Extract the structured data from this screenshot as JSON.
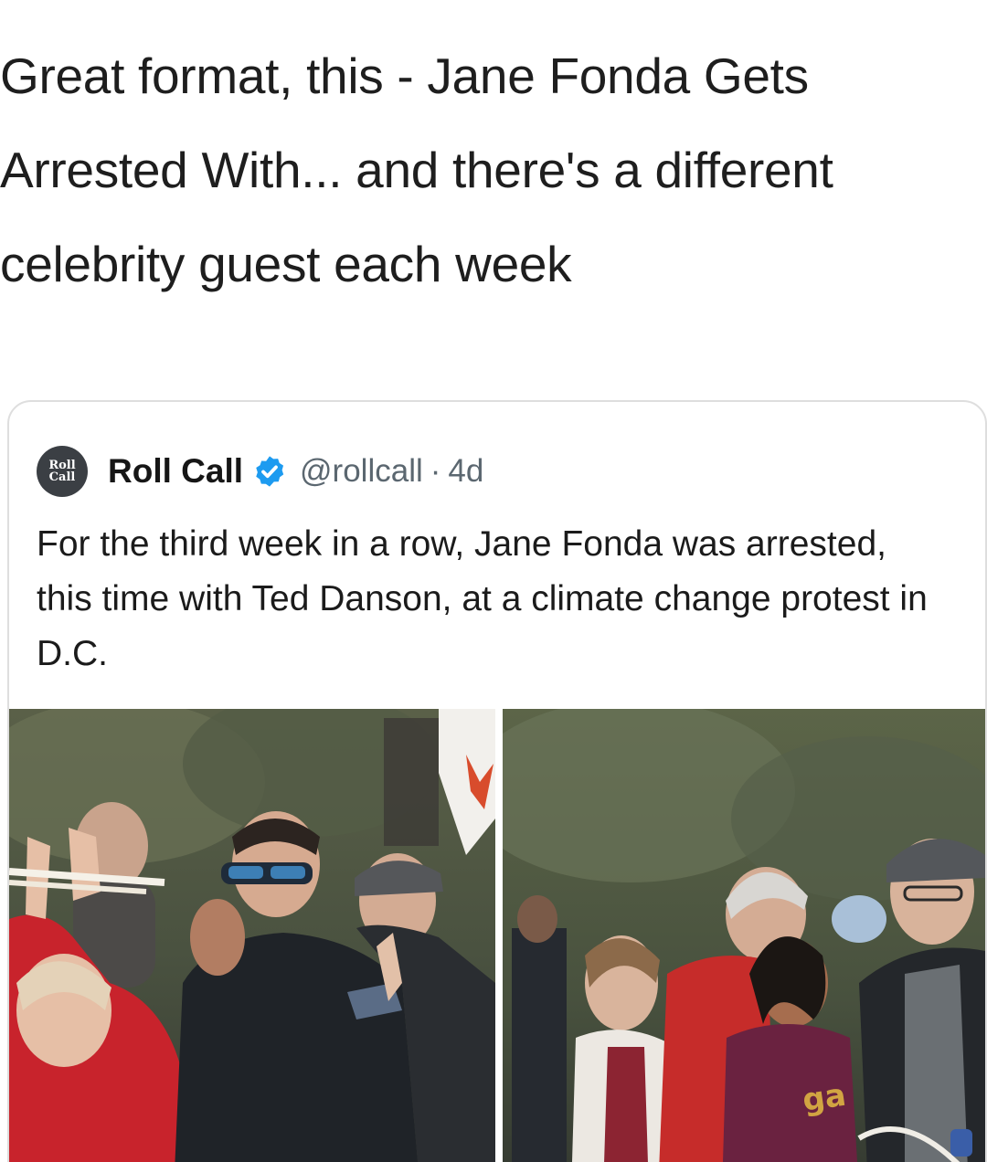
{
  "post": {
    "caption": "Great format, this - Jane Fonda Gets Arrested With... and there's a different celebrity guest each week"
  },
  "tweet": {
    "avatar": {
      "line1": "Roll",
      "line2": "Call"
    },
    "display_name": "Roll Call",
    "verified_icon": "verified-badge-icon",
    "handle": "@rollcall",
    "separator": "·",
    "time": "4d",
    "text": "For the third week in a row, Jane Fonda was arrested, this time with Ted Danson, at a climate change protest in D.C.",
    "media": [
      {
        "name": "protest-photo-left"
      },
      {
        "name": "protest-photo-right"
      }
    ]
  },
  "colors": {
    "verified_blue": "#1d9bf0",
    "avatar_bg": "#3b3f44",
    "handle_gray": "#5b6770",
    "border": "#dedede"
  }
}
